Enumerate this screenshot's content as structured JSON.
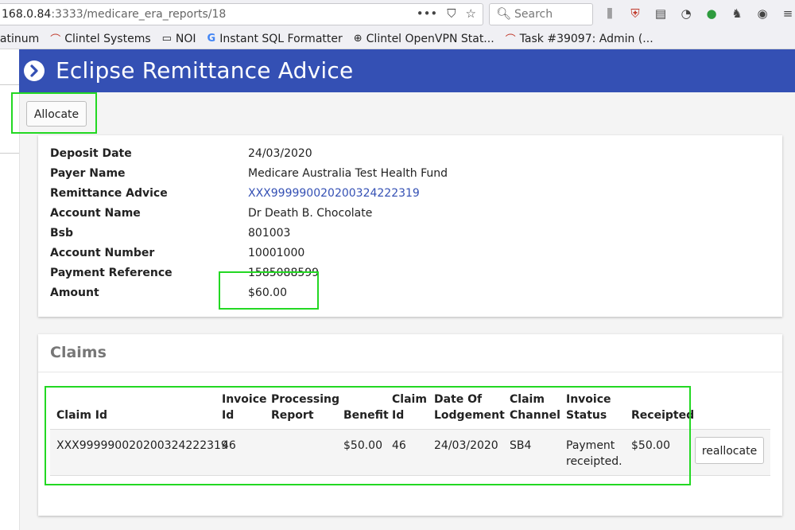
{
  "browser": {
    "url_host": "168.0.84",
    "url_rest": ":3333/medicare_era_reports/18",
    "search_placeholder": "Search",
    "bookmarks": [
      {
        "label": "latinum"
      },
      {
        "label": "Clintel Systems"
      },
      {
        "label": "NOI"
      },
      {
        "label": "Instant SQL Formatter"
      },
      {
        "label": "Clintel OpenVPN Stat..."
      },
      {
        "label": "Task #39097: Admin (..."
      }
    ]
  },
  "header": {
    "title": "Eclipse Remittance Advice"
  },
  "actions": {
    "allocate_label": "Allocate"
  },
  "remittance": {
    "fields": [
      {
        "label": "Deposit Date",
        "value": "24/03/2020"
      },
      {
        "label": "Payer Name",
        "value": "Medicare Australia Test Health Fund"
      },
      {
        "label": "Remittance Advice",
        "value": "XXX99999002020032422​2319"
      },
      {
        "label": "Account Name",
        "value": "Dr Death B. Chocolate"
      },
      {
        "label": "Bsb",
        "value": "801003"
      },
      {
        "label": "Account Number",
        "value": "10001000"
      },
      {
        "label": "Payment Reference",
        "value": "1585088599"
      },
      {
        "label": "Amount",
        "value": "$60.00"
      }
    ]
  },
  "claims": {
    "title": "Claims",
    "headers": {
      "claim_id": "Claim Id",
      "invoice_id_1": "Invoice",
      "invoice_id_2": "Id",
      "processing_1": "Processing",
      "processing_2": "Report",
      "benefit": "Benefit",
      "claim_id2_1": "Claim",
      "claim_id2_2": "Id",
      "date_1": "Date Of",
      "date_2": "Lodgement",
      "channel_1": "Claim",
      "channel_2": "Channel",
      "status_1": "Invoice",
      "status_2": "Status",
      "receipted": "Receipted"
    },
    "row": {
      "claim_id": "XXX99999002020032422​2319",
      "invoice_id": "46",
      "processing_report": "",
      "benefit": "$50.00",
      "claim_number": "46",
      "date_of_lodgement": "24/03/2020",
      "claim_channel": "SB4",
      "invoice_status_1": "Payment",
      "invoice_status_2": "receipted.",
      "receipted": "$50.00",
      "reallocate_label": "reallocate"
    }
  },
  "colors": {
    "header_bg": "#3450b4",
    "link": "#3450b4",
    "highlight": "#23d823"
  }
}
